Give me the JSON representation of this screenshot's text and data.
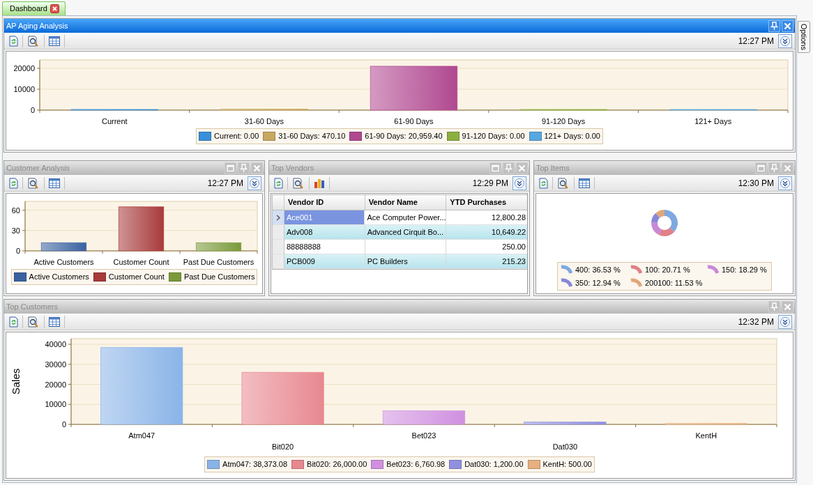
{
  "tab": {
    "label": "Dashboard",
    "selected": true
  },
  "side_tab": {
    "label": "Options"
  },
  "panels": [
    {
      "title": "AP Aging Analysis",
      "active": true,
      "buttons": [
        {
          "kind": "pin"
        },
        {
          "kind": "close"
        }
      ],
      "time": "12:27 PM",
      "content": {
        "kind": "bar_chart",
        "chart_data": {
          "type": "bar",
          "categories": [
            "Current",
            "31-60 Days",
            "61-90 Days",
            "91-120 Days",
            "121+ Days"
          ],
          "values": [
            0,
            500,
            21000,
            0,
            0
          ],
          "ylim": [
            0,
            24000
          ],
          "yticks": [
            0,
            10000,
            20000
          ],
          "grid": true
        },
        "legend": [
          {
            "label": "Current: 0.00",
            "color": "#3a8fd8"
          },
          {
            "label": "31-60 Days: 470.10",
            "color": "#c8a860"
          },
          {
            "label": "61-90 Days: 20,959.40",
            "color": "#b04890"
          },
          {
            "label": "91-120 Days: 0.00",
            "color": "#8cb040"
          },
          {
            "label": "121+ Days: 0.00",
            "color": "#58a8e0"
          }
        ]
      }
    },
    {
      "title": "Customer Analysis",
      "active": false,
      "buttons": [
        {
          "kind": "maximize"
        },
        {
          "kind": "pin"
        },
        {
          "kind": "close"
        }
      ],
      "time": "12:27 PM",
      "content": {
        "kind": "bar_chart",
        "chart_data": {
          "type": "bar",
          "categories": [
            "Active Customers",
            "Customer Count",
            "Past Due Customers"
          ],
          "values": [
            12,
            65,
            12
          ],
          "ylim": [
            0,
            73
          ],
          "yticks": [
            0,
            30,
            60
          ],
          "grid": true
        },
        "legend": [
          {
            "label": "Active Customers",
            "color": "#3a62a0"
          },
          {
            "label": "Customer Count",
            "color": "#a83a3a"
          },
          {
            "label": "Past Due Customers",
            "color": "#7a9a3a"
          }
        ]
      }
    },
    {
      "title": "Top Vendors",
      "active": false,
      "buttons": [
        {
          "kind": "maximize"
        },
        {
          "kind": "pin"
        },
        {
          "kind": "close"
        }
      ],
      "time": "12:29 PM",
      "content": {
        "kind": "table",
        "columns": [
          "Vendor ID",
          "Vendor Name",
          "YTD Purchases"
        ],
        "rows": [
          {
            "cells": [
              "Ace001",
              "Ace Computer Power...",
              "12,800.28"
            ],
            "selected": true
          },
          {
            "cells": [
              "Adv008",
              "Advanced Cirquit Bo...",
              "10,649.22"
            ],
            "selected": false
          },
          {
            "cells": [
              "88888888",
              "",
              "250.00"
            ],
            "selected": false
          },
          {
            "cells": [
              "PCB009",
              "PC Builders",
              "215.23"
            ],
            "selected": false
          }
        ]
      }
    },
    {
      "title": "Top Items",
      "active": false,
      "buttons": [
        {
          "kind": "maximize"
        },
        {
          "kind": "pin"
        },
        {
          "kind": "close"
        }
      ],
      "time": "12:30 PM",
      "content": {
        "kind": "donut",
        "chart_data": {
          "type": "donut",
          "values": [
            36.53,
            20.71,
            18.29,
            12.94,
            11.53
          ]
        },
        "legend": [
          {
            "label": "400: 36.53 %",
            "color": "#7ea8e0"
          },
          {
            "label": "100: 20.71 %",
            "color": "#e08088"
          },
          {
            "label": "150: 18.29 %",
            "color": "#c888d8"
          },
          {
            "label": "350: 12.94 %",
            "color": "#8888d8"
          },
          {
            "label": "200100: 11.53 %",
            "color": "#e0a878"
          }
        ]
      }
    },
    {
      "title": "Top Customers",
      "active": false,
      "buttons": [
        {
          "kind": "pin"
        },
        {
          "kind": "close"
        }
      ],
      "time": "12:32 PM",
      "content": {
        "kind": "bar_chart",
        "chart_data": {
          "type": "bar",
          "categories": [
            "Atm047",
            "Bit020",
            "Bet023",
            "Dat030",
            "KentH"
          ],
          "values": [
            38400,
            26000,
            6800,
            1200,
            500
          ],
          "ylabel": "Sales",
          "ylim": [
            0,
            42800
          ],
          "yticks": [
            0,
            10000,
            20000,
            30000,
            40000
          ],
          "grid": true
        },
        "legend": [
          {
            "label": "Atm047: 38,373.08",
            "color": "#8ab4e8"
          },
          {
            "label": "Bit020: 26,000.00",
            "color": "#e88890"
          },
          {
            "label": "Bet023: 6,760.98",
            "color": "#d090e0"
          },
          {
            "label": "Dat030: 1,200.00",
            "color": "#9090e0"
          },
          {
            "label": "KentH: 500.00",
            "color": "#e8b080"
          }
        ]
      }
    }
  ]
}
